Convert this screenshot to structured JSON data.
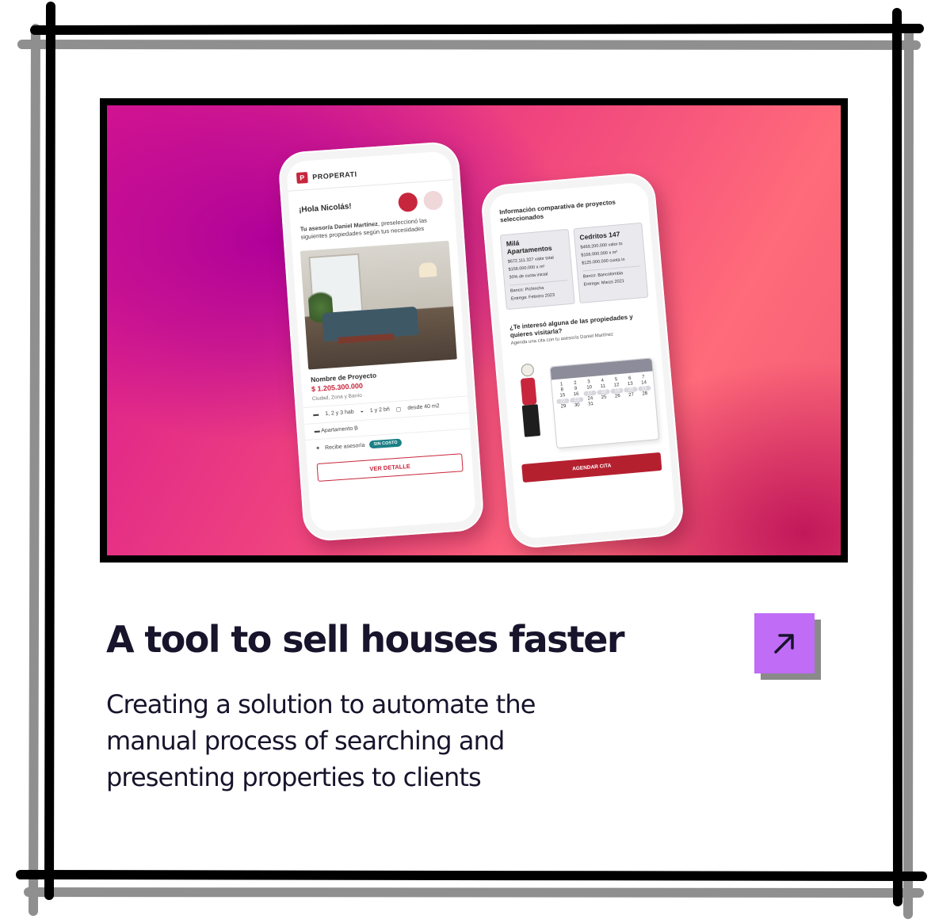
{
  "card": {
    "title": "A tool to sell houses faster",
    "description": "Creating a solution to automate the manual process of searching and presenting properties to clients",
    "link_icon": "arrow-up-right-icon",
    "accent_color": "#c06cf6",
    "text_color": "#17142b"
  },
  "hero": {
    "phone_left": {
      "brand": "PROPERATI",
      "greeting": "¡Hola Nicolás!",
      "intro_strong": "Tu asesor/a Daniel Martínez",
      "intro_rest": ", preseleccionó las siguientes propiedades según tus necesidades",
      "project_name": "Nombre de Proyecto",
      "price": "$ 1.205.300.000",
      "location": "Ciudad, Zona y Barrio",
      "feat_rooms": "1, 2 y 3 hab",
      "feat_baths": "1 y 2 bñ",
      "feat_area": "desde 40 m2",
      "type": "Apartamento B",
      "advice": "Recibe asesoría",
      "badge": "SIN COSTO",
      "cta": "VER DETALLE"
    },
    "phone_right": {
      "title": "Información comparativa de proyectos seleccionados",
      "card1": {
        "name": "Milá Apartamentos",
        "l1": "$672.111.327 valor total",
        "l2": "$156.000.000 x m²",
        "l3": "30% de cuota inicial",
        "l4": "Banco: Pichincha",
        "l5": "Entrega: Febrero 2023"
      },
      "card2": {
        "name": "Cedritos 147",
        "l1": "$469.200.000 valor to",
        "l2": "$156.000.000 x m²",
        "l3": "$125.000.000 cuota in",
        "l4": "Banco: Bancolombia",
        "l5": "Entrega: Marzo 2021"
      },
      "question": "¿Te interesó alguna de las propiedades y quieres visitarla?",
      "sub": "Agenda una cita con tu asesor/a Daniel Martínez",
      "calendar_days": [
        "1",
        "2",
        "3",
        "4",
        "5",
        "6",
        "7",
        "8",
        "9",
        "10",
        "11",
        "12",
        "13",
        "14",
        "15",
        "16",
        "17",
        "18",
        "19",
        "20",
        "21",
        "22",
        "23",
        "24",
        "25",
        "26",
        "27",
        "28",
        "29",
        "30",
        "31"
      ],
      "cta": "AGENDAR CITA"
    }
  }
}
